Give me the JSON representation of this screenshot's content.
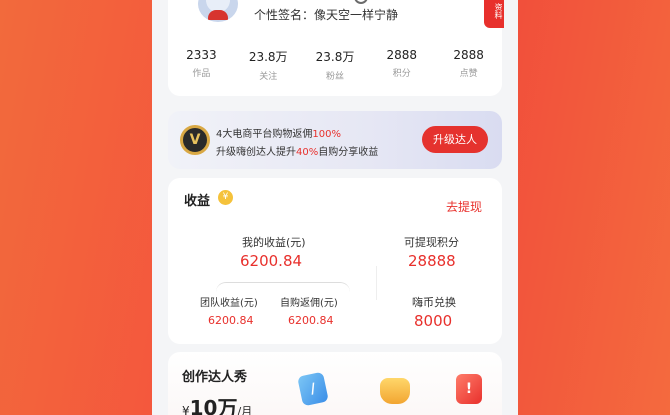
{
  "profile": {
    "signature": "个性签名：像天空一样宁静",
    "edit_tag": "资料",
    "stats": [
      {
        "value": "2333",
        "label": "作品"
      },
      {
        "value": "23.8万",
        "label": "关注"
      },
      {
        "value": "23.8万",
        "label": "粉丝"
      },
      {
        "value": "2888",
        "label": "积分"
      },
      {
        "value": "2888",
        "label": "点赞"
      }
    ]
  },
  "promo": {
    "line1_prefix": "4大电商平台购物返佣",
    "line1_highlight": "100%",
    "line2_prefix": "升级嗨创达人提升",
    "line2_highlight": "40%",
    "line2_suffix": "自购分享收益",
    "button": "升级达人",
    "badge": "V"
  },
  "earnings": {
    "title": "收益",
    "coin_symbol": "¥",
    "withdraw": "去提现",
    "my_label": "我的收益(元)",
    "my_value": "6200.84",
    "team_label": "团队收益(元)",
    "team_value": "6200.84",
    "self_label": "自购返佣(元)",
    "self_value": "6200.84",
    "points_label": "可提现积分",
    "points_value": "28888",
    "coin_label": "嗨币兑换",
    "coin_value": "8000"
  },
  "creator": {
    "title": "创作达人秀",
    "currency": "¥",
    "amount": "10万",
    "unit": "/月"
  },
  "colors": {
    "accent": "#e8302c",
    "coin": "#f5c23b"
  }
}
